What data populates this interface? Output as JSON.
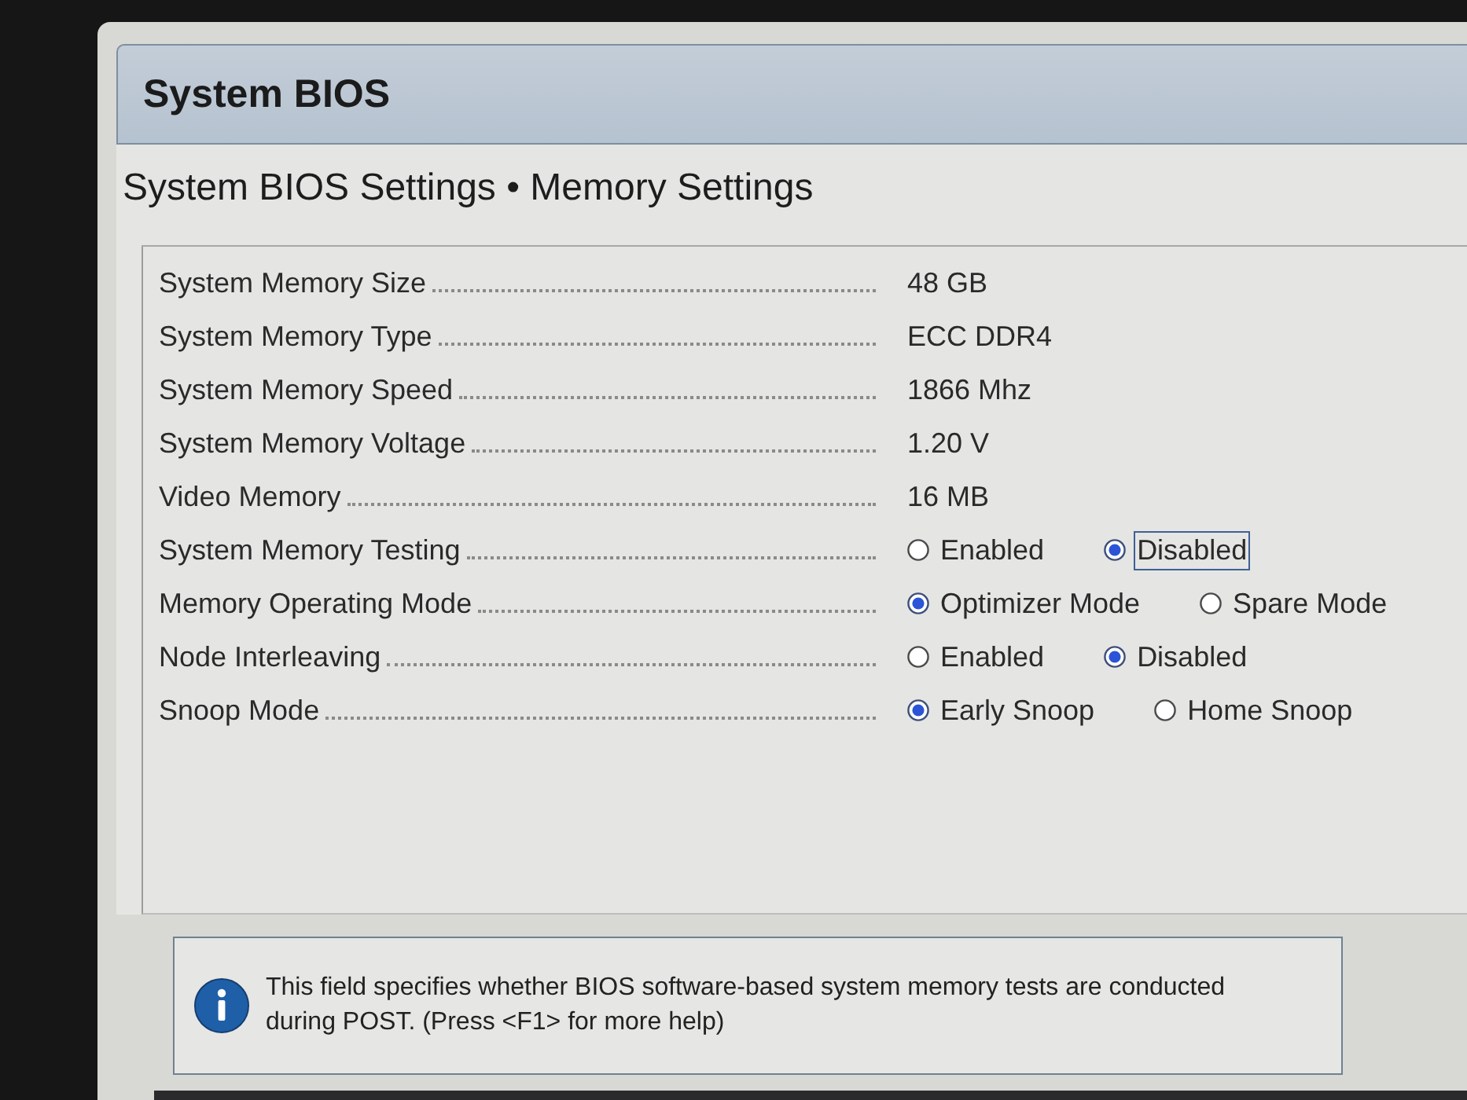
{
  "window": {
    "title": "System BIOS"
  },
  "page": {
    "title": "System BIOS Settings • Memory Settings"
  },
  "settings": [
    {
      "label": "System Memory Size",
      "kind": "value",
      "value": "48 GB"
    },
    {
      "label": "System Memory Type",
      "kind": "value",
      "value": "ECC DDR4"
    },
    {
      "label": "System Memory Speed",
      "kind": "value",
      "value": "1866 Mhz"
    },
    {
      "label": "System Memory Voltage",
      "kind": "value",
      "value": "1.20 V"
    },
    {
      "label": "Video Memory",
      "kind": "value",
      "value": "16 MB"
    },
    {
      "label": "System Memory Testing",
      "kind": "radio",
      "options": [
        {
          "label": "Enabled",
          "selected": false,
          "focused": false
        },
        {
          "label": "Disabled",
          "selected": true,
          "focused": true
        }
      ]
    },
    {
      "label": "Memory Operating Mode",
      "kind": "radio",
      "options": [
        {
          "label": "Optimizer Mode",
          "selected": true,
          "focused": false
        },
        {
          "label": "Spare Mode",
          "selected": false,
          "focused": false
        }
      ]
    },
    {
      "label": "Node Interleaving",
      "kind": "radio",
      "options": [
        {
          "label": "Enabled",
          "selected": false,
          "focused": false
        },
        {
          "label": "Disabled",
          "selected": true,
          "focused": false
        }
      ]
    },
    {
      "label": "Snoop Mode",
      "kind": "radio",
      "options": [
        {
          "label": "Early Snoop",
          "selected": true,
          "focused": false
        },
        {
          "label": "Home Snoop",
          "selected": false,
          "focused": false
        }
      ]
    }
  ],
  "help": {
    "text": "This field specifies whether BIOS software-based system memory tests are conducted during POST. (Press <F1> for more help)"
  }
}
